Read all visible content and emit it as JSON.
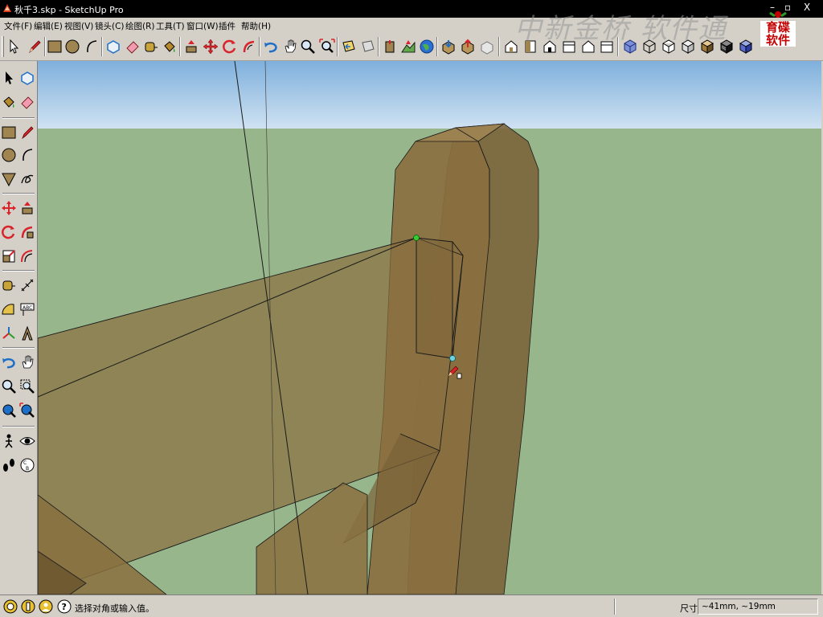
{
  "window": {
    "title": "秋千3.skp - SketchUp Pro",
    "controls": {
      "minimize": "–",
      "restore": "▫",
      "close": "X"
    }
  },
  "menu": {
    "items": [
      {
        "label": "文件(F)"
      },
      {
        "label": "编辑(E)"
      },
      {
        "label": "视图(V)"
      },
      {
        "label": "镜头(C)"
      },
      {
        "label": "绘图(R)"
      },
      {
        "label": "工具(T)"
      },
      {
        "label": "窗口(W)"
      },
      {
        "label": "插件"
      },
      {
        "label": "帮助(H)"
      }
    ]
  },
  "watermark": {
    "text": "中新金桥 软件通",
    "logo_line1": "育碟",
    "logo_line2": "软件"
  },
  "toolbar_top": {
    "groups": [
      [
        "select",
        "pencil"
      ],
      [
        "rectangle",
        "circle",
        "arc"
      ],
      [
        "make-component",
        "eraser",
        "tape-measure",
        "paint-bucket"
      ],
      [
        "push-pull",
        "move",
        "rotate",
        "follow-me"
      ],
      [
        "orbit",
        "pan",
        "zoom",
        "zoom-extents"
      ],
      [
        "previous-view",
        "next-view"
      ],
      [
        "add-location",
        "toggle-terrain",
        "get-models",
        "share-model"
      ],
      [
        "component-browser",
        "share-component"
      ],
      [
        "iso-view",
        "top-view",
        "front-view",
        "right-view",
        "back-view",
        "left-view"
      ],
      [
        "xray-style",
        "wireframe-style",
        "hidden-line-style",
        "shaded-style",
        "shaded-textures-style",
        "monochrome-style"
      ]
    ]
  },
  "toolbar_left": {
    "tools": [
      "select",
      "make-component",
      "paint-bucket",
      "eraser",
      "rectangle",
      "pencil",
      "circle",
      "arc",
      "polygon",
      "freehand",
      "move",
      "push-pull",
      "rotate",
      "follow-me",
      "scale",
      "offset",
      "tape-measure",
      "dimension",
      "protractor",
      "text",
      "axes",
      "3d-text",
      "orbit",
      "pan",
      "zoom",
      "zoom-window",
      "previous-view",
      "zoom-extents",
      "position-camera",
      "look-around",
      "walk",
      "section-plane"
    ]
  },
  "viewport": {
    "sky_color": "#a9cbe6",
    "ground_color": "#98b68c",
    "model_color": "#8a7040",
    "edge_color": "#1a1a1a"
  },
  "status": {
    "message": "选择对角或输入值。",
    "measurement_label": "尺寸",
    "measurement_value": "~41mm, ~19mm"
  }
}
